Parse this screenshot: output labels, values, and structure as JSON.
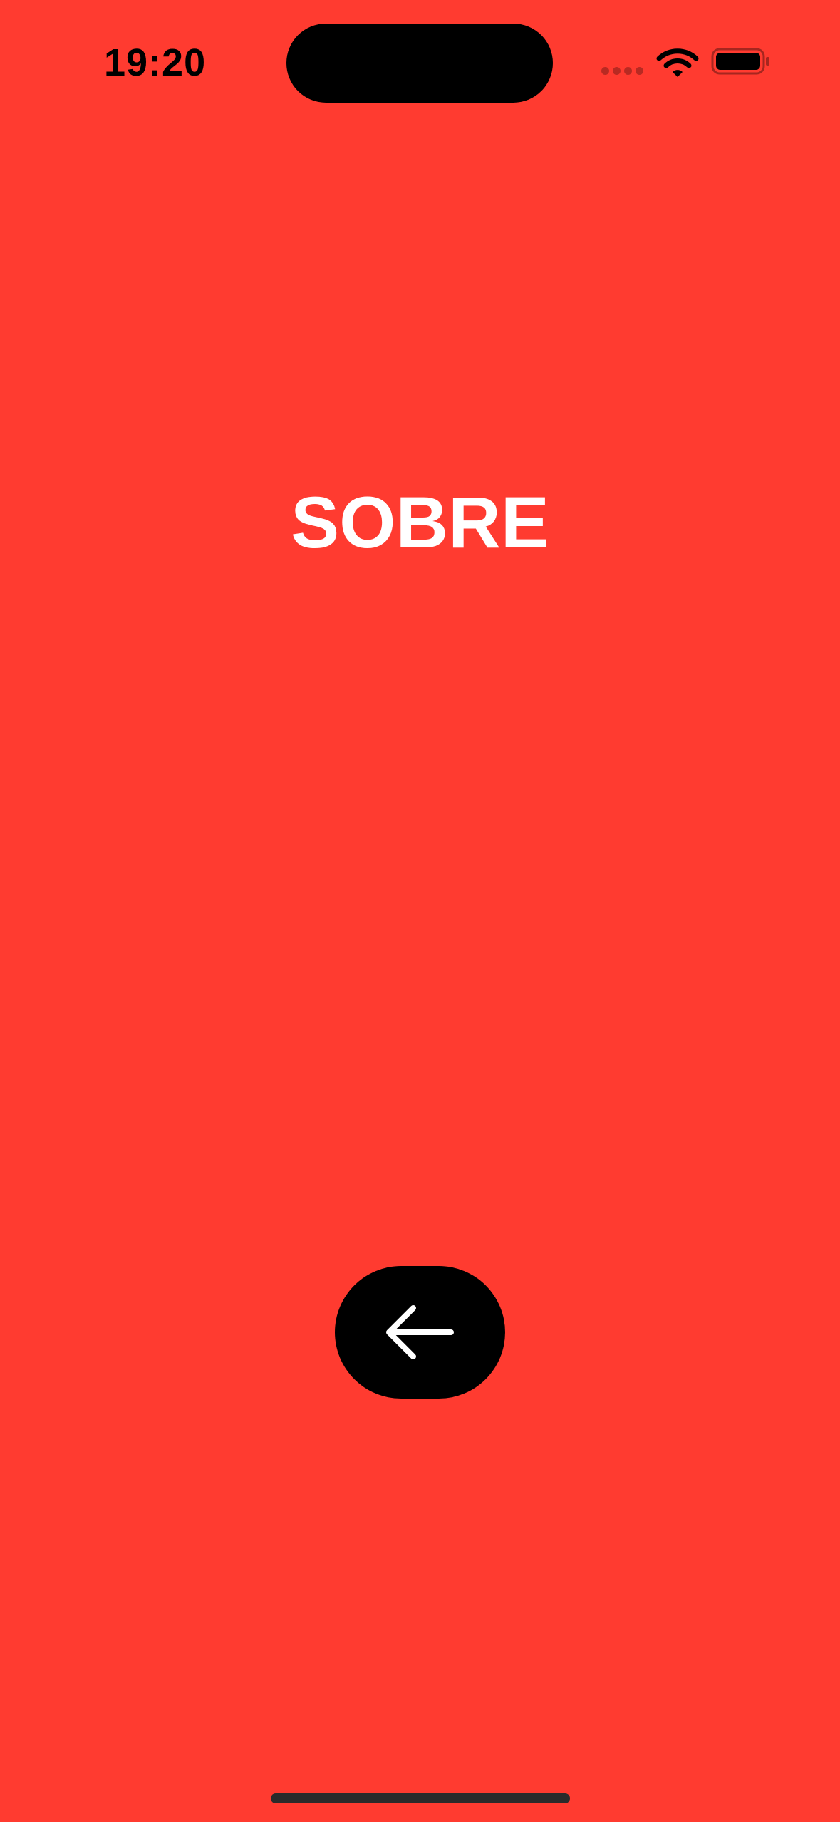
{
  "status_bar": {
    "time": "19:20",
    "icons": [
      "cellular-signal-icon",
      "wifi-icon",
      "battery-icon"
    ]
  },
  "main": {
    "title": "SOBRE",
    "back_button_icon": "arrow-left-icon"
  },
  "colors": {
    "background": "#FF3B30",
    "title_text": "#FFFFFF",
    "button_background": "#000000",
    "button_icon": "#FFFFFF"
  }
}
